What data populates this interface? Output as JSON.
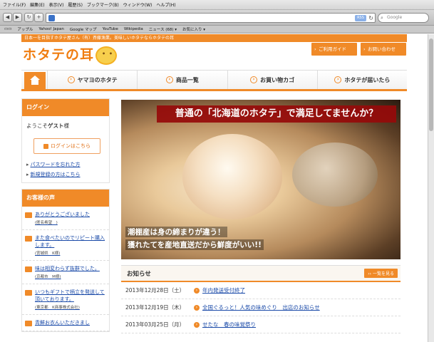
{
  "browser": {
    "menus": [
      "ファイル(F)",
      "編集(E)",
      "表示(V)",
      "履歴(S)",
      "ブックマーク(B)",
      "ウィンドウ(W)",
      "ヘルプ(H)"
    ],
    "rss_label": "RSS",
    "search_placeholder": "Google",
    "bookmarks": [
      "アップル",
      "Yahoo! Japan",
      "Google マップ",
      "YouTube",
      "Wikipedia",
      "ニュース (68) ▾",
      "お気に入り ▾"
    ]
  },
  "header": {
    "tagline": "日本一を目指すホタテ屋さん（有）斉藤漁業。美味しいホタテならホタテの耳",
    "logo_text": "ホタテの耳",
    "guide_button": "ご利用ガイド",
    "contact_button": "お問い合わせ"
  },
  "nav": {
    "items": [
      "ヤマヨのホタテ",
      "商品一覧",
      "お買い物カゴ",
      "ホタテが届いたら"
    ]
  },
  "sidebar": {
    "login_title": "ログイン",
    "welcome_prefix": "ようこそ",
    "welcome_user": "ゲスト",
    "welcome_suffix": "様",
    "login_button": "ログインはこちら",
    "forgot_link": "パスワードを忘れた方",
    "register_link": "新規登録の方はこちら",
    "voice_title": "お客様の声",
    "voices": [
      {
        "text": "ありがとうございました",
        "who": "(匿名希望　)"
      },
      {
        "text": "また食べたいのでリピート購入します。",
        "who": "(宮城県　K様)"
      },
      {
        "text": "味は相変わらず抜群でした。",
        "who": "(京都市　M様)"
      },
      {
        "text": "いつもギフトで柄立を発送して頂いております。",
        "who": "(東京都　K商事株式会社)"
      },
      {
        "text": "青鮮お衣んいただきまし",
        "who": ""
      }
    ]
  },
  "main": {
    "hero_catch": "普通の「北海道のホタテ」で満足してませんか？",
    "hero_sub1": "潮棚産は身の締まりが違う！",
    "hero_sub2": "獲れたてを産地直送だから鮮度がいい!!",
    "news_title": "お知らせ",
    "news_more": "›› 一覧を見る",
    "news": [
      {
        "date": "2013年12月28日（土）",
        "title": "年内発送受付終了"
      },
      {
        "date": "2013年12月19日（木）",
        "title": "全国ぐるっと！人気の味めぐり　出店のお知らせ"
      },
      {
        "date": "2013年03月25日（月）",
        "title": "せたな　春の味覚祭り"
      }
    ]
  }
}
